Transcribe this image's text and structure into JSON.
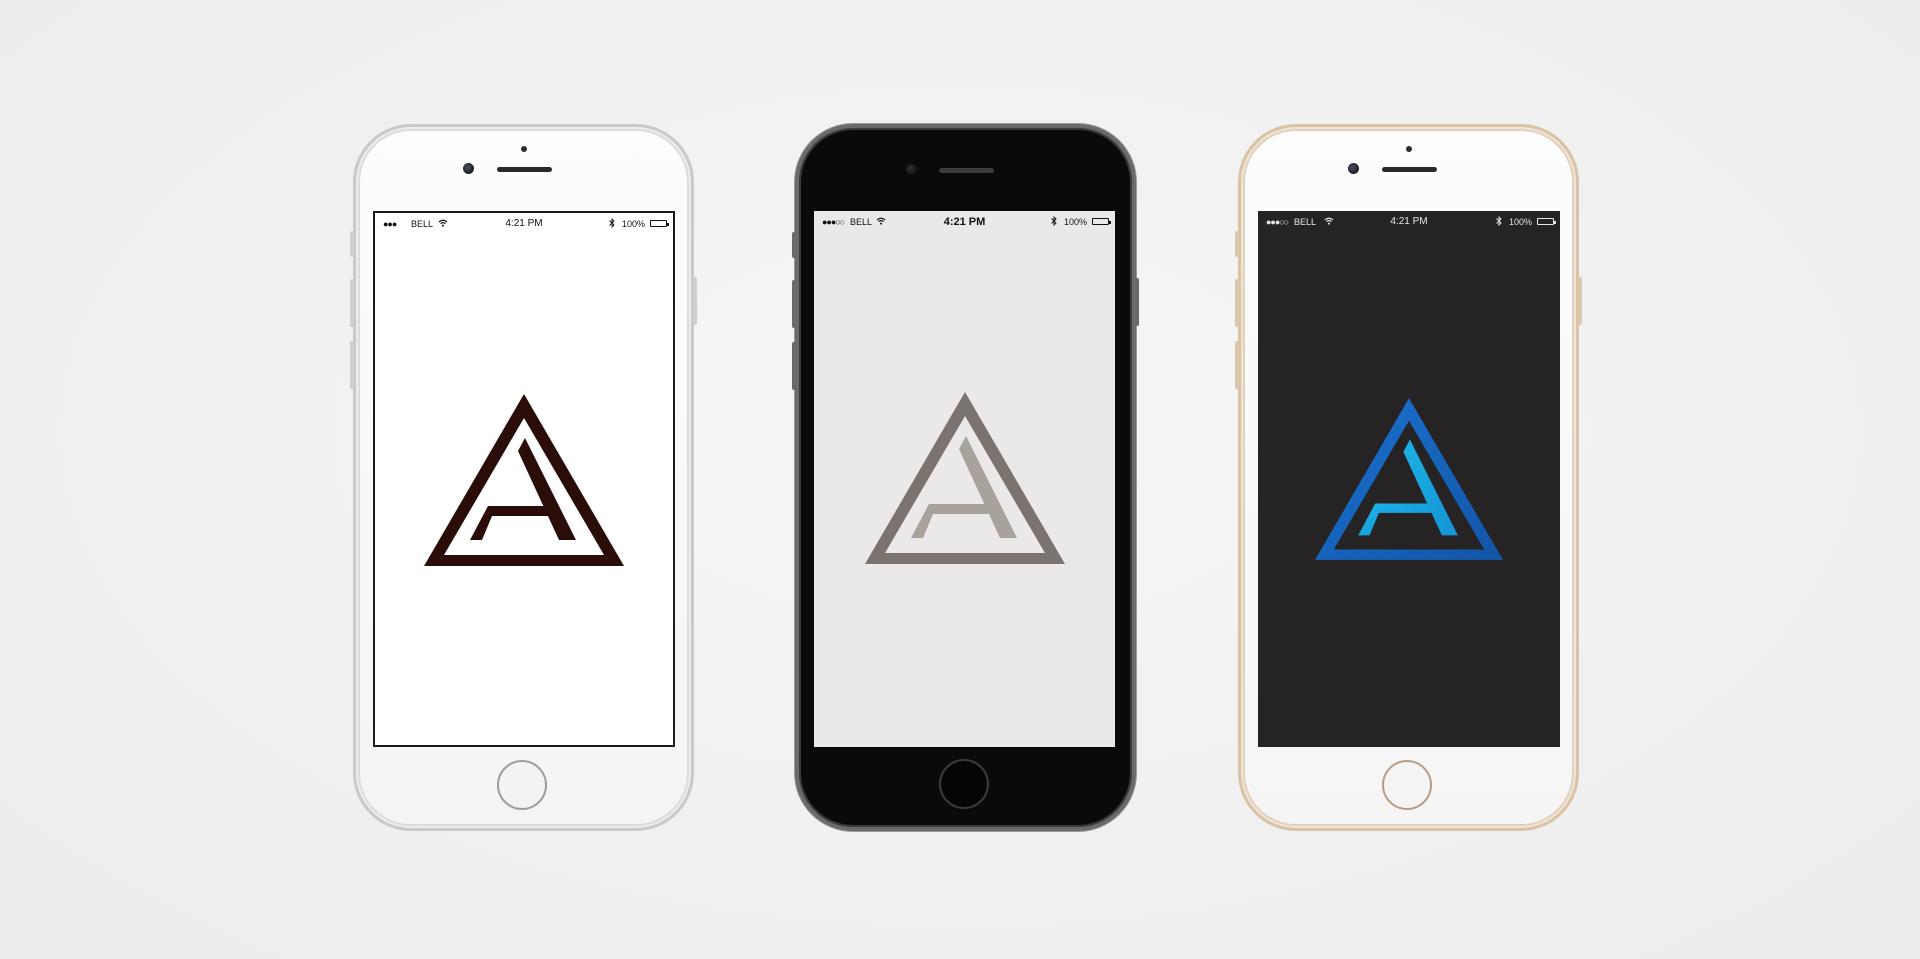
{
  "phones": [
    {
      "finish": "silver",
      "screen_background": "#ffffff",
      "logo_color": "#2a0c08",
      "statusbar": {
        "signal": "●●●",
        "carrier": "BELL",
        "time": "4:21 PM",
        "battery_pct": "100%",
        "battery_level": 1.0
      }
    },
    {
      "finish": "space-gray",
      "screen_background": "#eae8e8",
      "logo_color": "#7a736f",
      "logo_inner_color": "#a8a29d",
      "statusbar": {
        "signal": "●●●○○",
        "carrier": "BELL",
        "time": "4:21 PM",
        "battery_pct": "100%",
        "battery_level": 1.0
      }
    },
    {
      "finish": "gold",
      "screen_background": "#262324",
      "logo_color": "#1565c0",
      "logo_inner_color": "#1aa3dc",
      "statusbar": {
        "signal": "●●●○○",
        "carrier": "BELL",
        "time": "4:21 PM",
        "battery_pct": "100%",
        "battery_level": 1.0
      }
    }
  ]
}
